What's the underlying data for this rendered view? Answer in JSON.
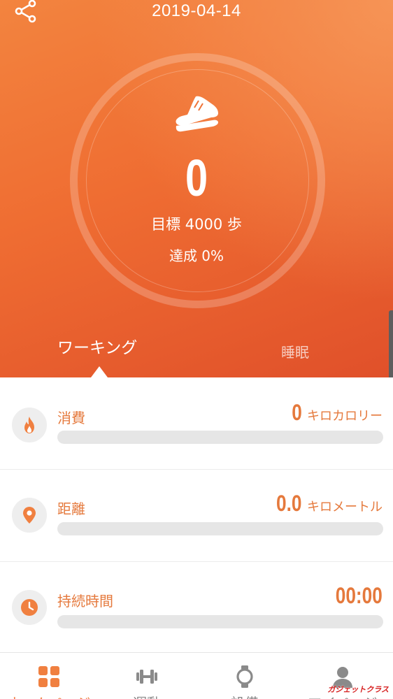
{
  "header": {
    "date": "2019-04-14"
  },
  "steps": {
    "count": "0",
    "goal_text": "目標 4000 歩",
    "achievement_text": "達成 0%"
  },
  "tabs": {
    "walking": "ワーキング",
    "sleep": "睡眠"
  },
  "metrics": [
    {
      "label": "消費",
      "value": "0",
      "unit": "キロカロリー",
      "icon": "fire-icon",
      "progress": 0
    },
    {
      "label": "距離",
      "value": "0.0",
      "unit": "キロメートル",
      "icon": "location-pin-icon",
      "progress": 0
    },
    {
      "label": "持続時間",
      "value": "00:00",
      "unit": "",
      "icon": "clock-icon",
      "progress": 0
    }
  ],
  "nav": [
    {
      "label": "ホームページ",
      "icon": "grid-icon",
      "active": true
    },
    {
      "label": "運動",
      "icon": "dumbbell-icon",
      "active": false
    },
    {
      "label": "設備",
      "icon": "watch-icon",
      "active": false
    },
    {
      "label": "マイページ",
      "icon": "person-icon",
      "active": false
    }
  ],
  "watermark": "ガジェットクラス",
  "colors": {
    "accent": "#f08040",
    "hero_start": "#f3843f",
    "hero_end": "#e0502a",
    "text_orange": "#e5793c"
  }
}
